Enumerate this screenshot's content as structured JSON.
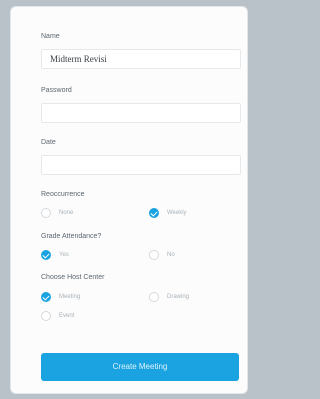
{
  "form": {
    "name": {
      "label": "Name",
      "value": "Midterm Revisi"
    },
    "password": {
      "label": "Password",
      "value": ""
    },
    "date": {
      "label": "Date",
      "value": ""
    },
    "recurrence": {
      "label": "Reoccurrence",
      "options": [
        {
          "label": "None",
          "checked": false
        },
        {
          "label": "Weekly",
          "checked": true
        }
      ]
    },
    "grade_attendance": {
      "label": "Grade Attendance?",
      "options": [
        {
          "label": "Yes",
          "checked": true
        },
        {
          "label": "No",
          "checked": false
        }
      ]
    },
    "host_center": {
      "label": "Choose Host Center",
      "options": [
        {
          "label": "Meeting",
          "checked": true
        },
        {
          "label": "Drawing",
          "checked": false
        },
        {
          "label": "Event",
          "checked": false
        }
      ]
    },
    "submit_label": "Create Meeting"
  },
  "colors": {
    "accent": "#1aa3e0",
    "background": "#b9c2c8",
    "card": "#fcfcfc"
  }
}
